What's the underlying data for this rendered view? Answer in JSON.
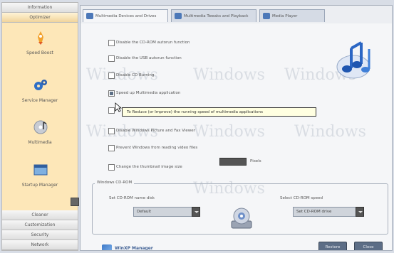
{
  "sidebar": {
    "top_groups": [
      {
        "label": "Information"
      },
      {
        "label": "Optimizer"
      }
    ],
    "items": [
      {
        "label": "Speed Boost",
        "icon": "rocket-icon"
      },
      {
        "label": "Service Manager",
        "icon": "gears-icon"
      },
      {
        "label": "Multimedia",
        "icon": "cd-music-icon"
      },
      {
        "label": "Startup Manager",
        "icon": "window-icon"
      }
    ],
    "bottom_groups": [
      {
        "label": "Cleaner"
      },
      {
        "label": "Customization"
      },
      {
        "label": "Security"
      },
      {
        "label": "Network"
      }
    ]
  },
  "tabs": [
    {
      "label": "Multimedia Devices and Drives",
      "active": true
    },
    {
      "label": "Multimedia Tweaks and Playback",
      "active": false
    },
    {
      "label": "Media Player",
      "active": false
    }
  ],
  "watermark_text": "Windows",
  "options": [
    {
      "label": "Disable the CD-ROM autorun function",
      "checked": false
    },
    {
      "label": "Disable the USB autorun function",
      "checked": false
    },
    {
      "label": "Disable CD Burning",
      "checked": false
    },
    {
      "label": "Speed up Multimedia application",
      "checked": true
    },
    {
      "label": "",
      "checked": false
    },
    {
      "label": "Disable Windows Picture and Fax Viewer",
      "checked": false
    },
    {
      "label": "Prevent Windows from reading video files",
      "checked": false
    },
    {
      "label": "Change the thumbnail image size",
      "checked": false
    }
  ],
  "thumbnail_size": {
    "value": "",
    "suffix": "Pixels"
  },
  "tooltip": "To Reduce (or Improve) the running speed of multimedia applications",
  "cdrom": {
    "group_title": "Windows CD-ROM",
    "name_label": "Set CD-ROM name disk",
    "name_value": "Default",
    "speed_label": "Select CD-ROM speed",
    "speed_value": "Set CD-ROM drive"
  },
  "buttons": {
    "apply": "Restore",
    "close": "Close"
  },
  "brand": "WinXP Manager"
}
